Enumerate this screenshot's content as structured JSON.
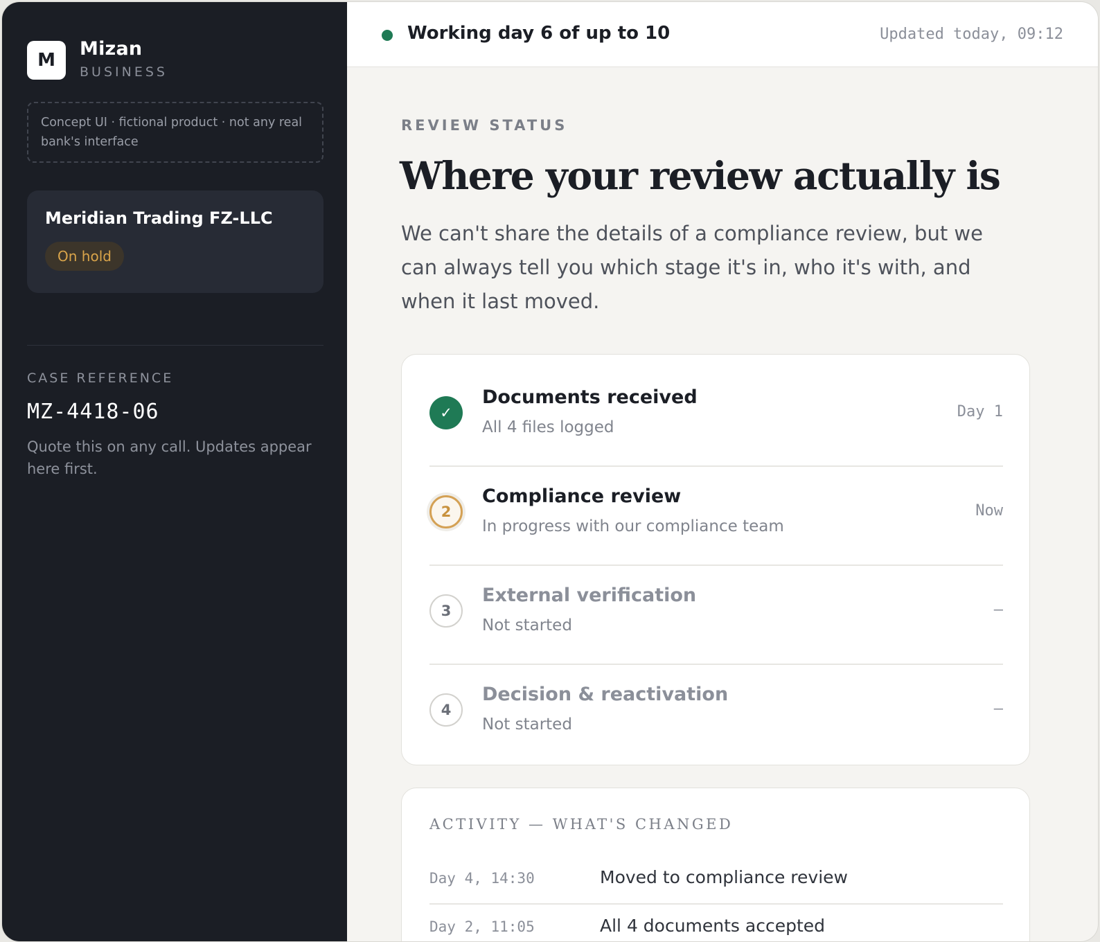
{
  "brand": {
    "logo_letter": "M",
    "name": "Mizan",
    "tagline": "BUSINESS"
  },
  "concept_note": "Concept UI · fictional product · not any real bank's interface",
  "account": {
    "name": "Meridian Trading FZ-LLC",
    "status": "On hold"
  },
  "case": {
    "label": "CASE REFERENCE",
    "reference": "MZ-4418-06",
    "hint": "Quote this on any call. Updates appear here first."
  },
  "topbar": {
    "working_day": "Working day 6 of up to 10",
    "updated": "Updated today, 09:12"
  },
  "review": {
    "eyebrow": "REVIEW STATUS",
    "headline": "Where your review actually is",
    "intro": "We can't share the details of a compliance review, but we can always tell you which stage it's in, who it's with, and when it last moved."
  },
  "stages": [
    {
      "marker": "✓",
      "title": "Documents received",
      "subtitle": "All 4 files logged",
      "when": "Day 1",
      "state": "done"
    },
    {
      "marker": "2",
      "title": "Compliance review",
      "subtitle": "In progress with our compliance team",
      "when": "Now",
      "state": "active"
    },
    {
      "marker": "3",
      "title": "External verification",
      "subtitle": "Not started",
      "when": "–",
      "state": "todo"
    },
    {
      "marker": "4",
      "title": "Decision & reactivation",
      "subtitle": "Not started",
      "when": "–",
      "state": "todo"
    }
  ],
  "activity": {
    "title": "ACTIVITY — WHAT'S CHANGED",
    "items": [
      {
        "time": "Day 4, 14:30",
        "text": "Moved to compliance review"
      },
      {
        "time": "Day 2, 11:05",
        "text": "All 4 documents accepted"
      }
    ]
  },
  "colors": {
    "sidebar_bg": "#1b1e25",
    "accent_green": "#1f7a55",
    "status_amber": "#d9a44a",
    "page_bg": "#f5f4f1"
  }
}
